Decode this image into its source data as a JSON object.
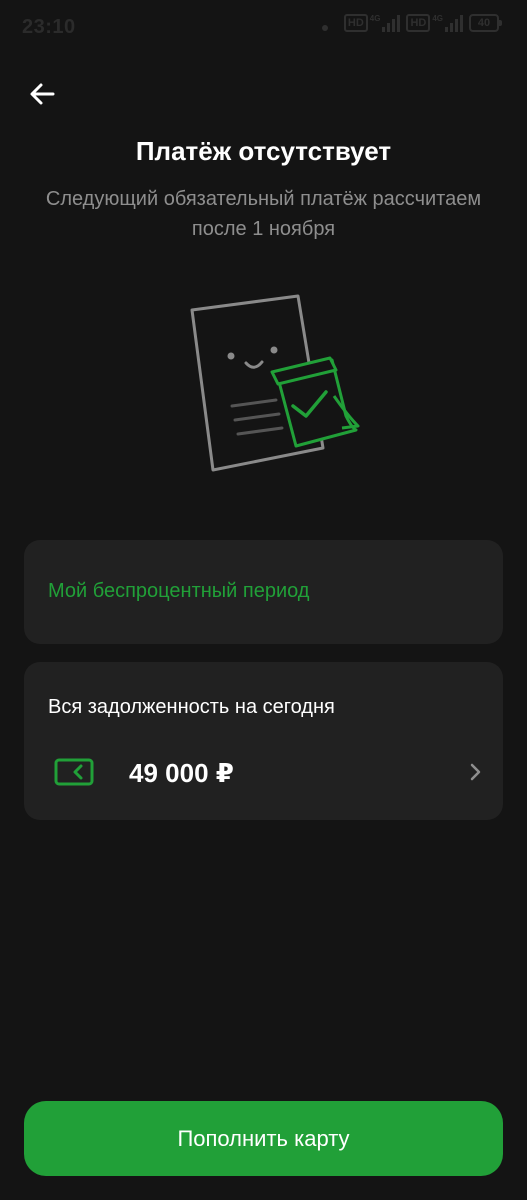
{
  "status_bar": {
    "time": "23:10",
    "hd1": "HD",
    "g1": "4G",
    "hd2": "HD",
    "g2": "4G",
    "battery": "40"
  },
  "header": {
    "title": "Платёж отсутствует",
    "subtitle": "Следующий обязательный платёж рассчитаем после 1 ноября"
  },
  "period_card": {
    "link_label": "Мой беспроцентный период"
  },
  "debt_card": {
    "label": "Вся задолженность на сегодня",
    "amount": "49 000 ₽"
  },
  "footer": {
    "topup_label": "Пополнить карту"
  },
  "colors": {
    "accent": "#21a038",
    "background": "#141414",
    "card": "#212121"
  },
  "icons": {
    "back": "arrow-left-icon",
    "illustration": "document-checkmark-icon",
    "card": "card-icon",
    "chevron": "chevron-right-icon"
  }
}
